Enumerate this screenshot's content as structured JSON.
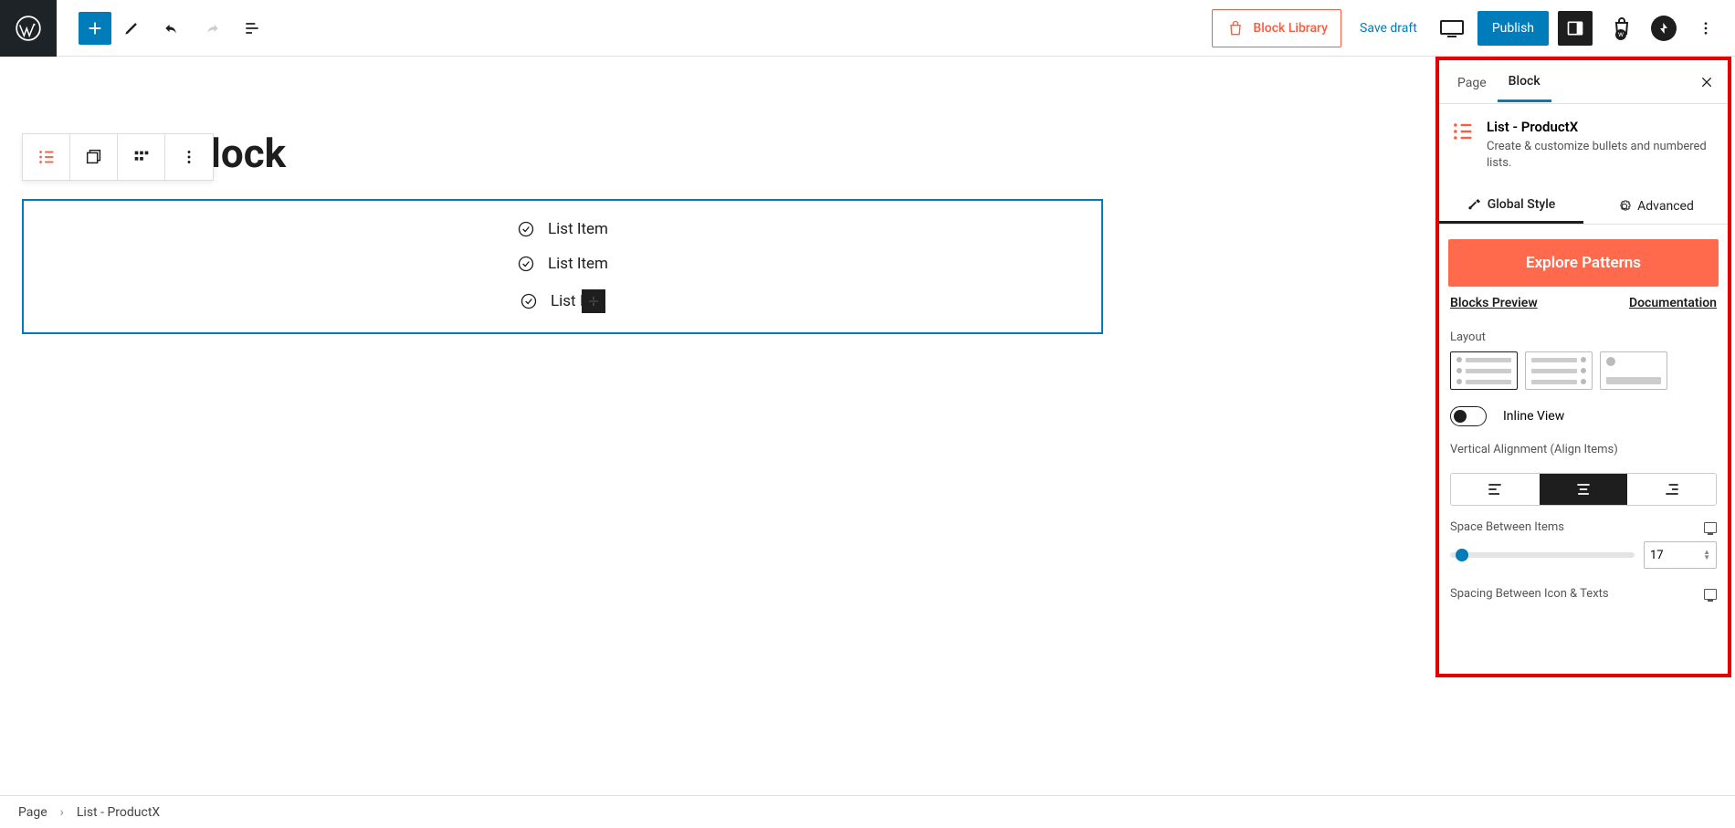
{
  "topbar": {
    "block_library_label": "Block Library",
    "save_draft_label": "Save draft",
    "publish_label": "Publish"
  },
  "canvas": {
    "page_title": "ist Block",
    "page_title_full_hint": "…ist Block",
    "list_items": [
      "List Item",
      "List Item",
      "List It"
    ]
  },
  "sidebar": {
    "tab_page": "Page",
    "tab_block": "Block",
    "block_name": "List - ProductX",
    "block_desc": "Create & customize bullets and numbered lists.",
    "subtab_global": "Global Style",
    "subtab_advanced": "Advanced",
    "explore_label": "Explore Patterns",
    "blocks_preview": "Blocks Preview",
    "documentation": "Documentation",
    "layout_label": "Layout",
    "inline_view_label": "Inline View",
    "valign_label": "Vertical Alignment (Align Items)",
    "space_between_label": "Space Between Items",
    "space_value": "17",
    "spacing_icon_text_label": "Spacing Between Icon & Texts"
  },
  "breadcrumb": {
    "root": "Page",
    "current": "List - ProductX"
  },
  "colors": {
    "accent_blue": "#007cba",
    "accent_orange": "#ff6a4d",
    "highlight_red": "#e60000"
  }
}
